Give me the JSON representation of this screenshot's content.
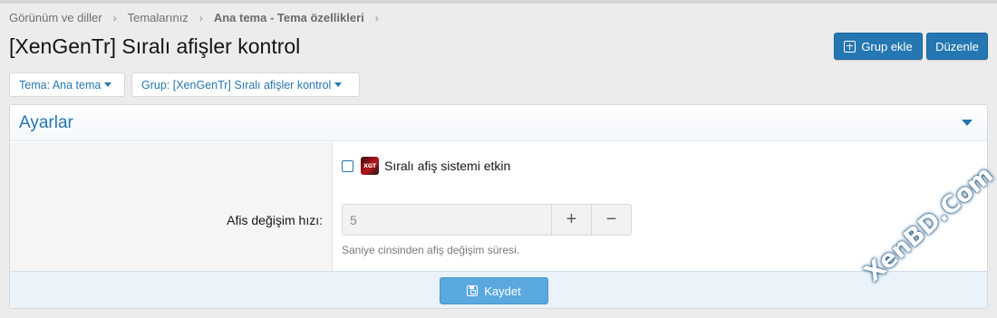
{
  "breadcrumb": [
    {
      "label": "Görünüm ve diller"
    },
    {
      "label": "Temalarınız"
    },
    {
      "label": "Ana tema - Tema özellikleri"
    }
  ],
  "page": {
    "title": "[XenGenTr] Sıralı afişler kontrol"
  },
  "actions": {
    "add_group_label": "Grup ekle",
    "edit_label": "Düzenle"
  },
  "filters": {
    "theme_label": "Tema: Ana tema",
    "group_label": "Grup: [XenGenTr] Sıralı afişler kontrol"
  },
  "panel": {
    "title": "Ayarlar",
    "checkbox_label": "Sıralı afiş sistemi etkin",
    "checkbox_checked": false,
    "addon_icon_text": "XGT",
    "speed_field": {
      "label": "Afis değişim hızı:",
      "value": "5",
      "hint": "Saniye cinsinden afiş değişim süresi."
    },
    "save_label": "Kaydet"
  },
  "watermark": "XenBD.Com",
  "colors": {
    "accent": "#2577b1",
    "save_button": "#5aa8e0",
    "footer_bg": "#eaf3fa"
  }
}
